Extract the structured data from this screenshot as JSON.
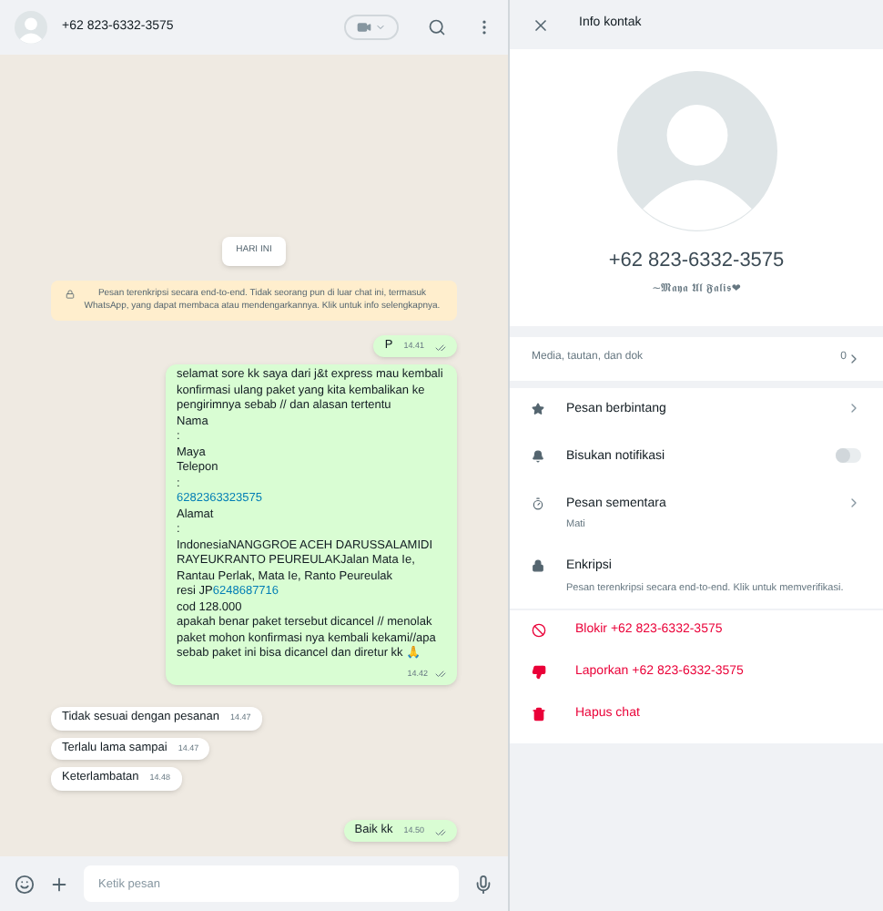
{
  "chat_header": {
    "title": "+62 823-6332-3575"
  },
  "chat": {
    "date_chip": "HARI INI",
    "encryption_notice": "Pesan terenkripsi secara end-to-end. Tidak seorang pun di luar chat ini, termasuk WhatsApp, yang dapat membaca atau mendengarkannya. Klik untuk info selengkapnya.",
    "messages": [
      {
        "kind": "outgoing",
        "time": "14.41",
        "lines": [
          [
            {
              "text": "P",
              "link": false
            }
          ]
        ]
      },
      {
        "kind": "outgoing",
        "time": "14.42",
        "lines": [
          [
            {
              "text": "selamat sore kk saya dari j&t express mau kembali konfirmasi ulang paket yang  kita kembalikan ke pengirimnya sebab // dan alasan tertentu",
              "link": false
            }
          ],
          [
            {
              "text": "Nama",
              "link": false
            }
          ],
          [
            {
              "text": ":",
              "link": false
            }
          ],
          [
            {
              "text": "Maya",
              "link": false
            }
          ],
          [
            {
              "text": "Telepon",
              "link": false
            }
          ],
          [
            {
              "text": ":",
              "link": false
            }
          ],
          [
            {
              "text": "6282363323575",
              "link": true
            }
          ],
          [
            {
              "text": "Alamat",
              "link": false
            }
          ],
          [
            {
              "text": ":",
              "link": false
            }
          ],
          [
            {
              "text": "IndonesiaNANGGROE ACEH DARUSSALAMIDI RAYEUKRANTO PEUREULAKJalan Mata Ie, Rantau Perlak, Mata Ie, Ranto Peureulak",
              "link": false
            }
          ],
          [
            {
              "text": "resi JP",
              "link": false
            },
            {
              "text": "6248687716",
              "link": true
            }
          ],
          [
            {
              "text": "cod 128.000",
              "link": false
            }
          ],
          [
            {
              "text": "apakah benar paket tersebut  dicancel // menolak paket mohon konfirmasi nya kembali kekami//apa sebab paket ini bisa dicancel dan diretur kk 🙏",
              "link": false
            }
          ]
        ]
      },
      {
        "kind": "incoming",
        "time": "14.47",
        "lines": [
          [
            {
              "text": "Tidak sesuai dengan pesanan",
              "link": false
            }
          ]
        ]
      },
      {
        "kind": "incoming",
        "time": "14.47",
        "lines": [
          [
            {
              "text": "Terlalu lama sampai",
              "link": false
            }
          ]
        ]
      },
      {
        "kind": "incoming",
        "time": "14.48",
        "lines": [
          [
            {
              "text": "Keterlambatan",
              "link": false
            }
          ]
        ]
      },
      {
        "kind": "outgoing",
        "time": "14.50",
        "lines": [
          [
            {
              "text": "Baik kk",
              "link": false
            }
          ]
        ]
      }
    ]
  },
  "composer": {
    "placeholder": "Ketik pesan"
  },
  "contact_info": {
    "title": "Info kontak",
    "phone": "+62 823-6332-3575",
    "about": "~𝕸𝖆𝖞𝖆 𝖀𝖑 𝕱𝖆𝖑𝖎𝖘❤",
    "media": {
      "label": "Media, tautan, dan dok",
      "count": "0"
    },
    "items": [
      {
        "kind": "link",
        "label": "Pesan berbintang"
      },
      {
        "kind": "toggle",
        "label": "Bisukan notifikasi",
        "on": false
      },
      {
        "kind": "link",
        "label": "Pesan sementara",
        "sub": "Mati"
      },
      {
        "kind": "plain",
        "label": "Enkripsi",
        "sub": "Pesan terenkripsi secara end-to-end. Klik untuk memverifikasi."
      }
    ],
    "actions": [
      {
        "label": "Blokir +62 823-6332-3575"
      },
      {
        "label": "Laporkan +62 823-6332-3575"
      },
      {
        "label": "Hapus chat"
      }
    ]
  }
}
